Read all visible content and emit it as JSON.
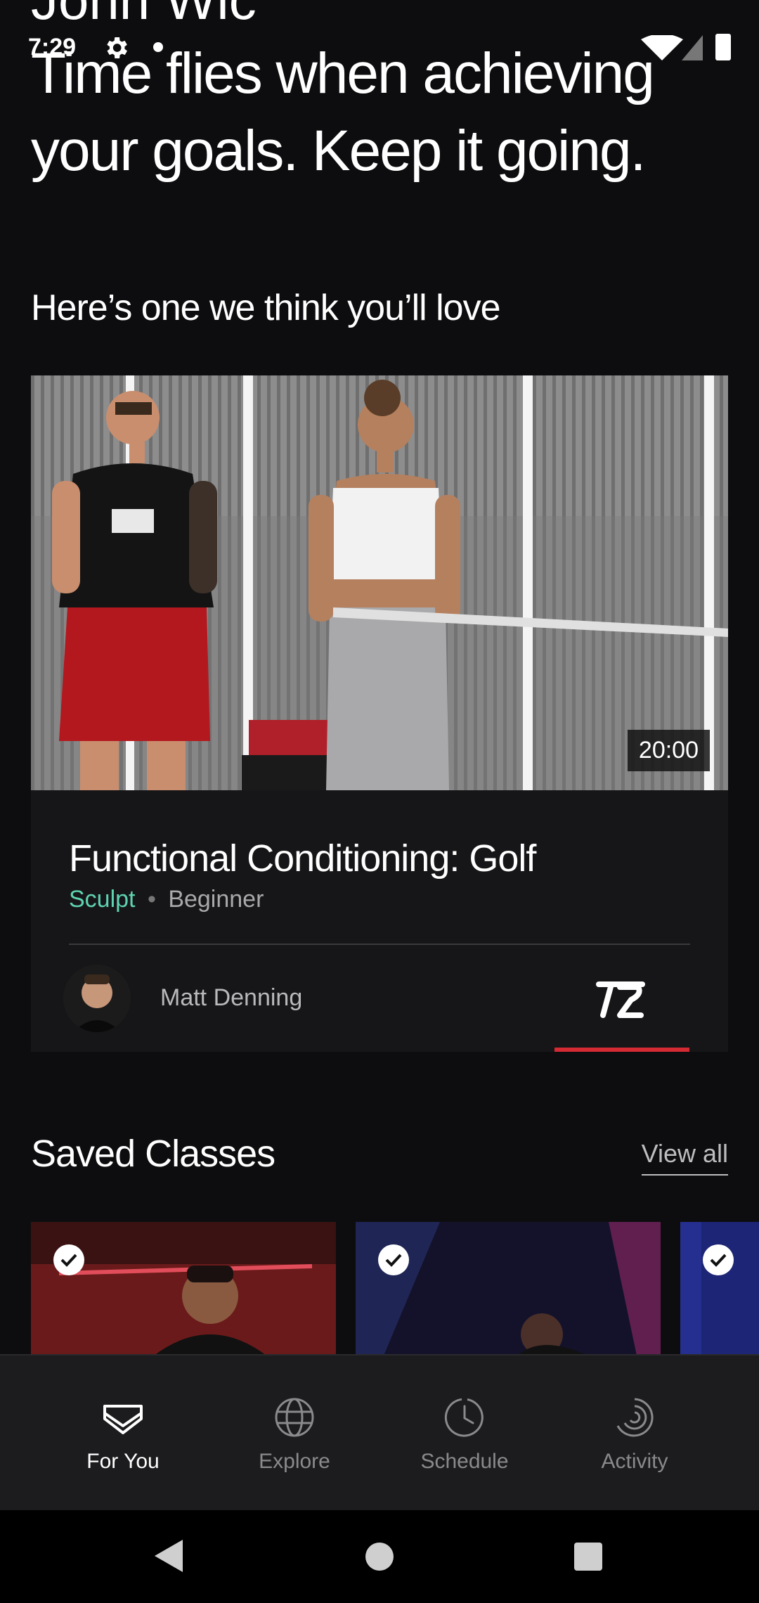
{
  "status_bar": {
    "time": "7:29"
  },
  "header": {
    "greeting_name": "John Wic",
    "greeting_message": "Time flies when achieving your goals. Keep it going."
  },
  "recommendation": {
    "heading": "Here’s one we think you’ll love",
    "duration": "20:00",
    "title": "Functional Conditioning: Golf",
    "category": "Sculpt",
    "separator": "•",
    "level": "Beginner",
    "instructor": "Matt Denning",
    "accent_color": "#d42a33",
    "category_color": "#5fd3b0"
  },
  "saved_classes": {
    "heading": "Saved Classes",
    "view_all": "View all"
  },
  "bottom_nav": {
    "items": [
      {
        "label": "For You",
        "icon": "for-you-icon",
        "active": true
      },
      {
        "label": "Explore",
        "icon": "globe-icon",
        "active": false
      },
      {
        "label": "Schedule",
        "icon": "clock-icon",
        "active": false
      },
      {
        "label": "Activity",
        "icon": "activity-rings-icon",
        "active": false
      }
    ]
  }
}
